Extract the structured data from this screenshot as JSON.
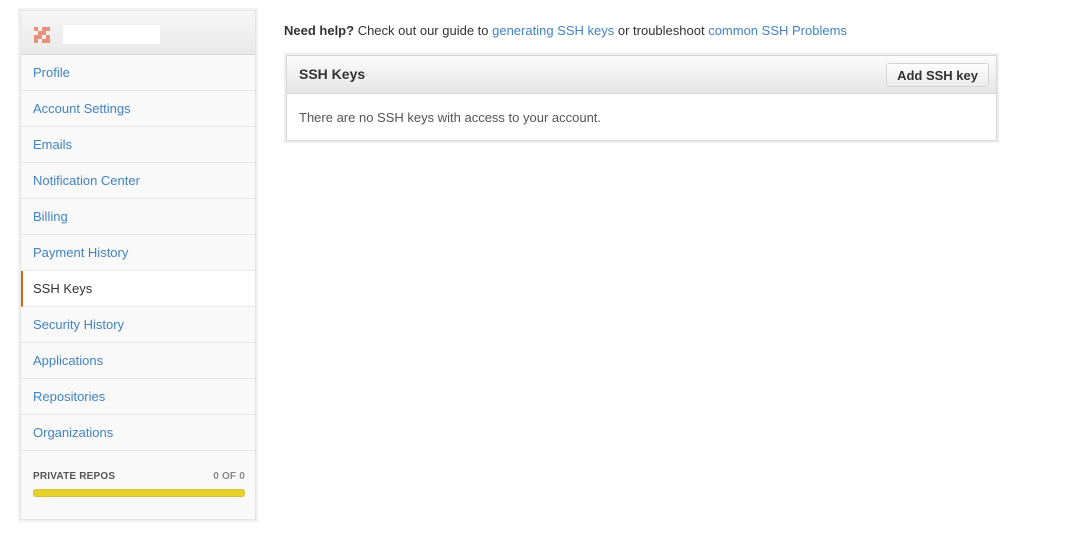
{
  "sidebar": {
    "items": [
      {
        "label": "Profile"
      },
      {
        "label": "Account Settings"
      },
      {
        "label": "Emails"
      },
      {
        "label": "Notification Center"
      },
      {
        "label": "Billing"
      },
      {
        "label": "Payment History"
      },
      {
        "label": "SSH Keys",
        "selected": true
      },
      {
        "label": "Security History"
      },
      {
        "label": "Applications"
      },
      {
        "label": "Repositories"
      },
      {
        "label": "Organizations"
      }
    ],
    "private_repos": {
      "label": "PRIVATE REPOS",
      "count": "0 OF 0",
      "used_fraction": 0
    }
  },
  "help": {
    "strong": "Need help?",
    "text1": " Check out our guide to ",
    "link1": "generating SSH keys",
    "text2": " or troubleshoot ",
    "link2": "common SSH Problems"
  },
  "panel": {
    "title": "SSH Keys",
    "add_button": "Add SSH key",
    "empty_message": "There are no SSH keys with access to your account."
  },
  "colors": {
    "link": "#4183c4",
    "selected_accent": "#d26911",
    "progress_bar": "#e7d12b"
  }
}
